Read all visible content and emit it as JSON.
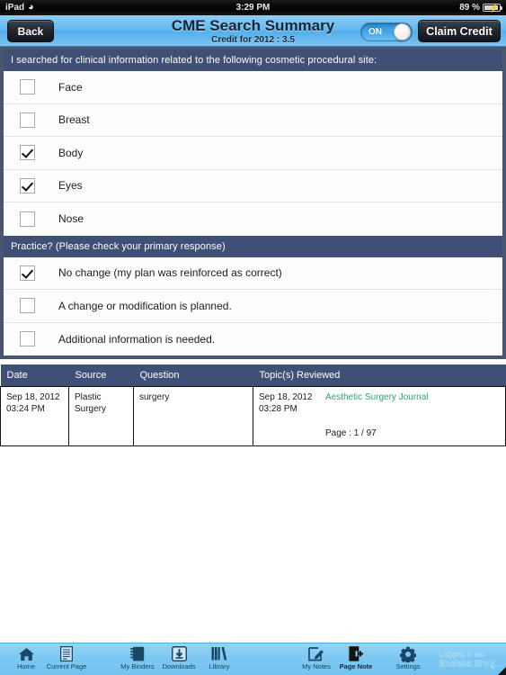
{
  "status_bar": {
    "device": "iPad",
    "wifi_icon": "wifi-icon",
    "time": "3:29 PM",
    "battery_percent": "89 %"
  },
  "navbar": {
    "back_label": "Back",
    "title": "CME Search Summary",
    "subtitle": "Credit for 2012 : 3.5",
    "toggle_label": "ON",
    "claim_label": "Claim Credit"
  },
  "sections": [
    {
      "header": "I searched for clinical information related to the following cosmetic procedural site:",
      "options": [
        {
          "label": "Face",
          "checked": false
        },
        {
          "label": "Breast",
          "checked": false
        },
        {
          "label": "Body",
          "checked": true
        },
        {
          "label": "Eyes",
          "checked": true
        },
        {
          "label": "Nose",
          "checked": false
        }
      ]
    },
    {
      "header": "Practice? (Please check your primary response)",
      "options": [
        {
          "label": "No change (my plan was reinforced as correct)",
          "checked": true
        },
        {
          "label": "A change or modification is planned.",
          "checked": false
        },
        {
          "label": "Additional information is needed.",
          "checked": false
        }
      ]
    }
  ],
  "table": {
    "columns": [
      "Date",
      "Source",
      "Question",
      "Topic(s) Reviewed"
    ],
    "rows": [
      {
        "date": "Sep 18, 2012\n03:24 PM",
        "source": "Plastic Surgery",
        "question": "surgery",
        "topic_date": "Sep 18, 2012\n03:28 PM",
        "topic_link": "Aesthetic Surgery Journal",
        "topic_page": "Page : 1 / 97"
      }
    ]
  },
  "toolbar": {
    "items": [
      {
        "label": "Home",
        "icon": "home-icon",
        "active": false
      },
      {
        "label": "Current Page",
        "icon": "document-icon",
        "active": false
      },
      {
        "label": "My Binders",
        "icon": "binder-icon",
        "active": false
      },
      {
        "label": "Downloads",
        "icon": "download-icon",
        "active": false
      },
      {
        "label": "Library",
        "icon": "library-icon",
        "active": false
      },
      {
        "label": "My Notes",
        "icon": "note-edit-icon",
        "active": false
      },
      {
        "label": "Page Note",
        "icon": "page-add-icon",
        "active": true
      },
      {
        "label": "Settings",
        "icon": "gear-icon",
        "active": false
      }
    ],
    "login_prefix": "Logged in as:",
    "login_user": "Shalaka Shirg..."
  },
  "colors": {
    "section_header": "#3f4f75",
    "panel_border": "#4a5670",
    "toolbar": "#7ec9f3",
    "navbar": "#63b8ee",
    "link_green": "#2fa96a"
  }
}
